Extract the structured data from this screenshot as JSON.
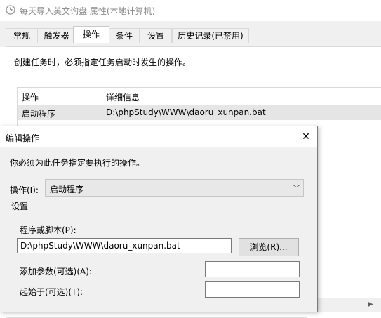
{
  "background_window": {
    "title": "每天导入英文询盘 属性(本地计算机)",
    "tabs": [
      "常规",
      "触发器",
      "操作",
      "条件",
      "设置",
      "历史记录(已禁用)"
    ],
    "active_tab": "操作",
    "intro_text": "创建任务时，必须指定任务启动时发生的操作。",
    "actions_table": {
      "columns": [
        "操作",
        "详细信息"
      ],
      "rows": [
        {
          "action": "启动程序",
          "details": "D:\\phpStudy\\WWW\\daoru_xunpan.bat"
        }
      ]
    },
    "scrollbar_right_arrow": "▶"
  },
  "dialog": {
    "title": "编辑操作",
    "close_glyph": "✕",
    "instruction": "你必须为此任务指定要执行的操作。",
    "action_label": "操作(I):",
    "action_value": "启动程序",
    "chevron_glyph": "﹀",
    "settings_group_label": "设置",
    "program_label": "程序或脚本(P):",
    "program_value": "D:\\phpStudy\\WWW\\daoru_xunpan.bat",
    "browse_label": "浏览(R)...",
    "args_label": "添加参数(可选)(A):",
    "args_value": "",
    "start_in_label": "起始于(可选)(T):",
    "start_in_value": ""
  }
}
